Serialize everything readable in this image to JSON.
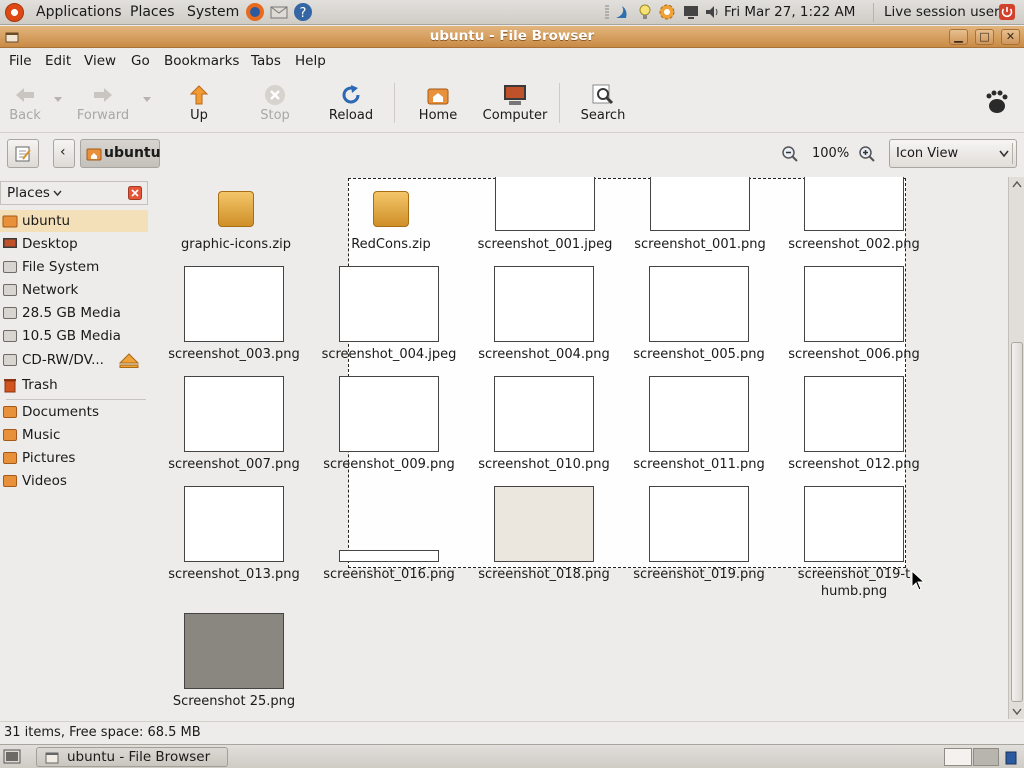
{
  "top_panel": {
    "menus": [
      "Applications",
      "Places",
      "System"
    ],
    "clock": "Fri Mar 27,  1:22 AM",
    "user": "Live session user"
  },
  "window": {
    "title": "ubuntu - File Browser"
  },
  "menubar": [
    "File",
    "Edit",
    "View",
    "Go",
    "Bookmarks",
    "Tabs",
    "Help"
  ],
  "toolbar": {
    "back": "Back",
    "forward": "Forward",
    "up": "Up",
    "stop": "Stop",
    "reload": "Reload",
    "home": "Home",
    "computer": "Computer",
    "search": "Search"
  },
  "location": {
    "current": "ubuntu",
    "zoom": "100%",
    "view_mode": "Icon View"
  },
  "sidebar": {
    "header": "Places",
    "items": [
      "ubuntu",
      "Desktop",
      "File System",
      "Network",
      "28.5 GB Media",
      "10.5 GB Media",
      "CD-RW/DV...",
      "Trash"
    ],
    "bookmarks": [
      "Documents",
      "Music",
      "Pictures",
      "Videos"
    ]
  },
  "files": {
    "f01": "graphic-icons.zip",
    "f02": "RedCons.zip",
    "f03": "screenshot_001.jpeg",
    "f04": "screenshot_001.png",
    "f05": "screenshot_002.png",
    "f06": "screenshot_003.png",
    "f07": "screenshot_004.jpeg",
    "f08": "screenshot_004.png",
    "f09": "screenshot_005.png",
    "f10": "screenshot_006.png",
    "f11": "screenshot_007.png",
    "f12": "screenshot_009.png",
    "f13": "screenshot_010.png",
    "f14": "screenshot_011.png",
    "f15": "screenshot_012.png",
    "f16": "screenshot_013.png",
    "f17": "screenshot_016.png",
    "f18": "screenshot_018.png",
    "f19": "screenshot_019.png",
    "f20": "screenshot_019-thumb.png",
    "f21": "Screenshot 25.png"
  },
  "status": {
    "text": "31 items, Free space: 68.5 MB"
  },
  "taskbar": {
    "task": "ubuntu - File Browser"
  },
  "colors": {
    "titlebar": "#d39a55",
    "selection": "#f3dfb8",
    "accent_close": "#e0502e"
  }
}
